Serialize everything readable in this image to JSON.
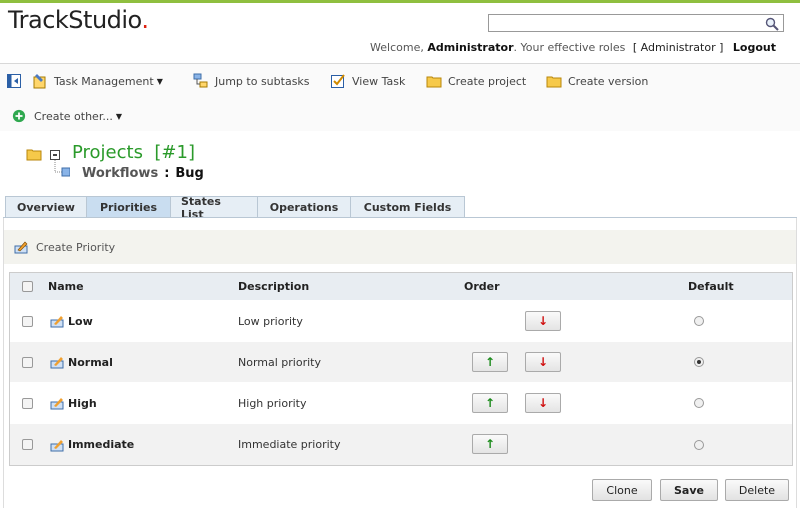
{
  "app": {
    "logo": "TrackStudio",
    "logo_dot": "."
  },
  "search": {
    "value": "",
    "placeholder": ""
  },
  "welcome": {
    "prefix": "Welcome,",
    "user": "Administrator",
    "roles_text": ". Your effective roles",
    "roles": "[ Administrator ]",
    "logout": "Logout"
  },
  "toolbar": {
    "task_management": "Task Management",
    "jump_to_subtasks": "Jump to subtasks",
    "view_task": "View Task",
    "create_project": "Create project",
    "create_version": "Create version",
    "create_other": "Create other..."
  },
  "breadcrumb": {
    "title": "Projects  [#1]",
    "sub": "Workflows",
    "sep": ":",
    "item": "Bug"
  },
  "tabs": [
    "Overview",
    "Priorities",
    "States List",
    "Operations",
    "Custom Fields"
  ],
  "active_tab": "Priorities",
  "action": {
    "create_priority": "Create Priority"
  },
  "table": {
    "headers": {
      "name": "Name",
      "description": "Description",
      "order": "Order",
      "default": "Default"
    },
    "rows": [
      {
        "name": "Low",
        "description": "Low priority",
        "up": false,
        "down": true,
        "default": false
      },
      {
        "name": "Normal",
        "description": "Normal priority",
        "up": true,
        "down": true,
        "default": true
      },
      {
        "name": "High",
        "description": "High priority",
        "up": true,
        "down": true,
        "default": false
      },
      {
        "name": "Immediate",
        "description": "Immediate priority",
        "up": true,
        "down": false,
        "default": false
      }
    ],
    "up_glyph": "↑",
    "down_glyph": "↓"
  },
  "buttons": {
    "clone": "Clone",
    "save": "Save",
    "delete": "Delete"
  },
  "colors": {
    "accent_green": "#2a9a2a",
    "top_bar": "#8fbf3f",
    "tab_active": "#c9ddf0"
  }
}
